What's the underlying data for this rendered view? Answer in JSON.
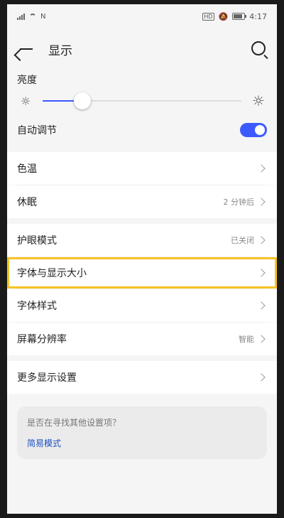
{
  "status_bar": {
    "time": "4:17",
    "nfc": "N",
    "hd": "HD"
  },
  "header": {
    "title": "显示"
  },
  "brightness": {
    "label": "亮度",
    "level_fraction": 0.2,
    "auto_adjust_label": "自动调节",
    "auto_adjust_on": true
  },
  "items": [
    {
      "label": "色温",
      "value": ""
    },
    {
      "label": "休眠",
      "value": "2 分钟后"
    },
    {
      "label": "护眼模式",
      "value": "已关闭"
    },
    {
      "label": "字体与显示大小",
      "value": ""
    },
    {
      "label": "字体样式",
      "value": ""
    },
    {
      "label": "屏幕分辨率",
      "value": "智能"
    },
    {
      "label": "更多显示设置",
      "value": ""
    }
  ],
  "suggestion": {
    "question": "是否在寻找其他设置项？",
    "link": "简易模式"
  },
  "colors": {
    "accent": "#3d5afe",
    "highlight": "#f7c324",
    "link": "#1a4fbf"
  }
}
